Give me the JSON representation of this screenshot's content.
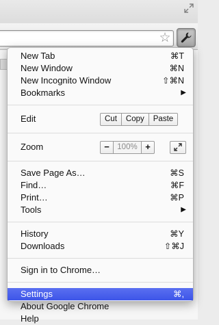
{
  "menu": {
    "group1": [
      {
        "name": "new-tab",
        "label": "New Tab",
        "shortcut": "⌘T"
      },
      {
        "name": "new-window",
        "label": "New Window",
        "shortcut": "⌘N"
      },
      {
        "name": "new-incognito-window",
        "label": "New Incognito Window",
        "shortcut": "⇧⌘N"
      },
      {
        "name": "bookmarks",
        "label": "Bookmarks",
        "submenu_arrow": "▶"
      }
    ],
    "edit": {
      "label": "Edit",
      "cut": "Cut",
      "copy": "Copy",
      "paste": "Paste"
    },
    "zoom": {
      "label": "Zoom",
      "minus": "−",
      "value": "100%",
      "plus": "+"
    },
    "group3": [
      {
        "name": "save-page-as",
        "label": "Save Page As…",
        "shortcut": "⌘S"
      },
      {
        "name": "find",
        "label": "Find…",
        "shortcut": "⌘F"
      },
      {
        "name": "print",
        "label": "Print…",
        "shortcut": "⌘P"
      },
      {
        "name": "tools",
        "label": "Tools",
        "submenu_arrow": "▶"
      }
    ],
    "group4": [
      {
        "name": "history",
        "label": "History",
        "shortcut": "⌘Y"
      },
      {
        "name": "downloads",
        "label": "Downloads",
        "shortcut": "⇧⌘J"
      }
    ],
    "signin": {
      "label": "Sign in to Chrome…"
    },
    "group6": [
      {
        "name": "settings",
        "label": "Settings",
        "shortcut": "⌘,",
        "highlighted": true
      },
      {
        "name": "about-google-chrome",
        "label": "About Google Chrome"
      },
      {
        "name": "help",
        "label": "Help"
      }
    ]
  },
  "icons": {
    "fullscreen": "fullscreen-arrows-icon",
    "bookmark_star": "star-icon",
    "menu_button": "wrench-icon"
  },
  "colors": {
    "highlight": "#4a62ec"
  }
}
